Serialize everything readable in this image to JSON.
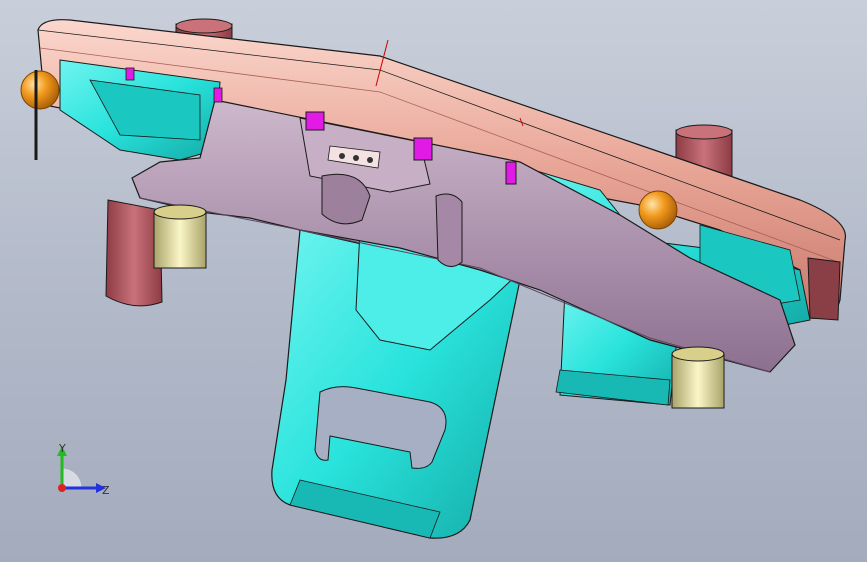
{
  "viewport": {
    "background_top": "#c9cfda",
    "background_bottom": "#a3abbd"
  },
  "model": {
    "colors": {
      "plate": "#e8a596",
      "plate_edge": "#c87a70",
      "pin": "#b85a62",
      "slider": "#b69ab4",
      "slider_dark": "#8f7390",
      "core": "#29e3dc",
      "core_dark": "#18b8b4",
      "magenta": "#e21ae5",
      "bushing": "#eee7a3",
      "sphere": "#f29a1e",
      "edge": "#1a1a1a"
    }
  },
  "triad": {
    "y_label": "Y",
    "z_label": "Z",
    "y_color": "#22bb22",
    "z_color": "#2233dd",
    "x_color": "#dd2222"
  }
}
